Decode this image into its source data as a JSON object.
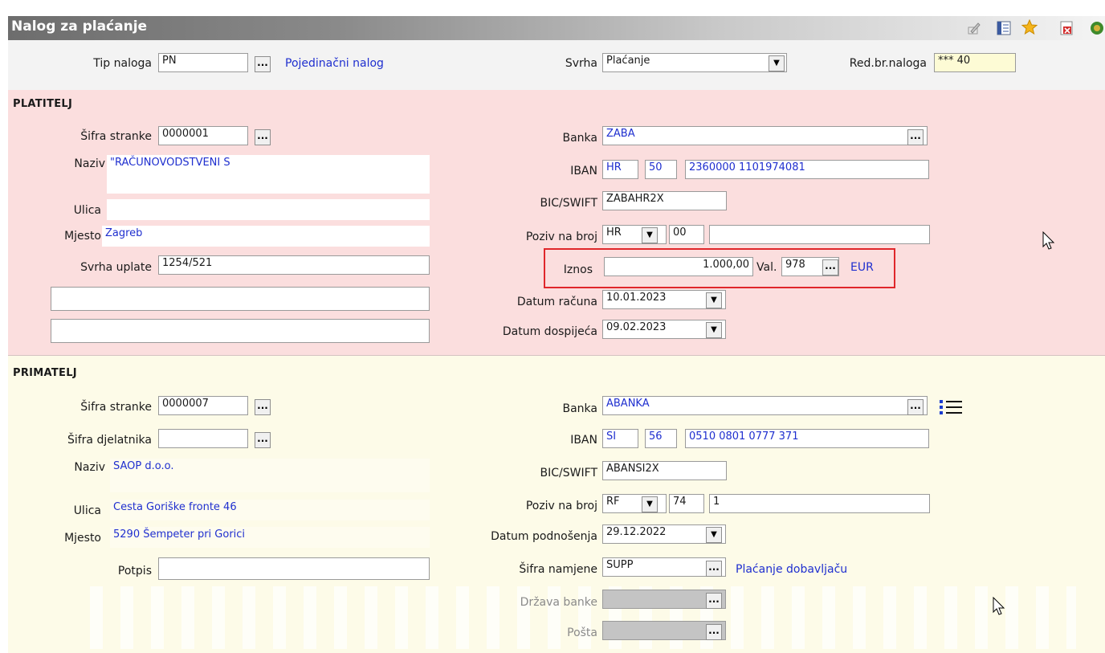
{
  "window": {
    "title": "Nalog za plaćanje"
  },
  "toolbar_icons": [
    "edit-icon",
    "layout-icon",
    "star-icon",
    "delete-icon",
    "exit-icon"
  ],
  "header": {
    "tip_naloga_label": "Tip naloga",
    "tip_naloga_value": "PN",
    "tip_naloga_desc": "Pojedinačni nalog",
    "svrha_label": "Svrha",
    "svrha_value": "Plaćanje",
    "red_br_label": "Red.br.naloga",
    "red_br_value": "*** 40"
  },
  "payer": {
    "section_title": "PLATITELJ",
    "sifra_stranke_label": "Šifra stranke",
    "sifra_stranke_value": "0000001",
    "naziv_label": "Naziv",
    "naziv_value": "\"RAČUNOVODSTVENI S",
    "ulica_label": "Ulica",
    "ulica_value": "",
    "mjesto_label": "Mjesto",
    "mjesto_value": "Zagreb",
    "svrha_uplate_label": "Svrha uplate",
    "svrha_uplate_value": "1254/521",
    "extra1_value": "",
    "extra2_value": "",
    "banka_label": "Banka",
    "banka_value": "ZABA",
    "iban_label": "IBAN",
    "iban_country": "HR",
    "iban_check": "50",
    "iban_number": "2360000 1101974081",
    "bic_label": "BIC/SWIFT",
    "bic_value": "ZABAHR2X",
    "poziv_label": "Poziv na broj",
    "poziv_model": "HR",
    "poziv_code": "00",
    "poziv_number": "",
    "iznos_label": "Iznos",
    "iznos_value": "1.000,00",
    "val_label": "Val.",
    "val_code": "978",
    "val_name": "EUR",
    "datum_racuna_label": "Datum računa",
    "datum_racuna_value": "10.01.2023",
    "datum_dospijeca_label": "Datum dospijeća",
    "datum_dospijeca_value": "09.02.2023"
  },
  "payee": {
    "section_title": "PRIMATELJ",
    "sifra_stranke_label": "Šifra stranke",
    "sifra_stranke_value": "0000007",
    "sifra_djelatnika_label": "Šifra djelatnika",
    "sifra_djelatnika_value": "",
    "naziv_label": "Naziv",
    "naziv_value": "SAOP d.o.o.",
    "ulica_label": "Ulica",
    "ulica_value": "Cesta Goriške fronte 46",
    "mjesto_label": "Mjesto",
    "mjesto_value": "5290 Šempeter pri Gorici",
    "potpis_label": "Potpis",
    "potpis_value": "",
    "banka_label": "Banka",
    "banka_value": "ABANKA",
    "iban_label": "IBAN",
    "iban_country": "SI",
    "iban_check": "56",
    "iban_number": "0510 0801 0777 371",
    "bic_label": "BIC/SWIFT",
    "bic_value": "ABANSI2X",
    "poziv_label": "Poziv na broj",
    "poziv_model": "RF",
    "poziv_code": "74",
    "poziv_number": "1",
    "datum_podnosenja_label": "Datum podnošenja",
    "datum_podnosenja_value": "29.12.2022",
    "sifra_namjene_label": "Šifra namjene",
    "sifra_namjene_value": "SUPP",
    "sifra_namjene_desc": "Plaćanje dobavljaču",
    "drzava_banke_label": "Država banke",
    "drzava_banke_value": "",
    "posta_label": "Pošta",
    "posta_value": ""
  },
  "glyphs": {
    "ellipsis": "...",
    "dropdown": "▼"
  },
  "colors": {
    "payer_bg": "#fbdede",
    "payee_bg": "#fdfbe8",
    "link": "#1f2fcf",
    "highlight": "#e0272b"
  }
}
